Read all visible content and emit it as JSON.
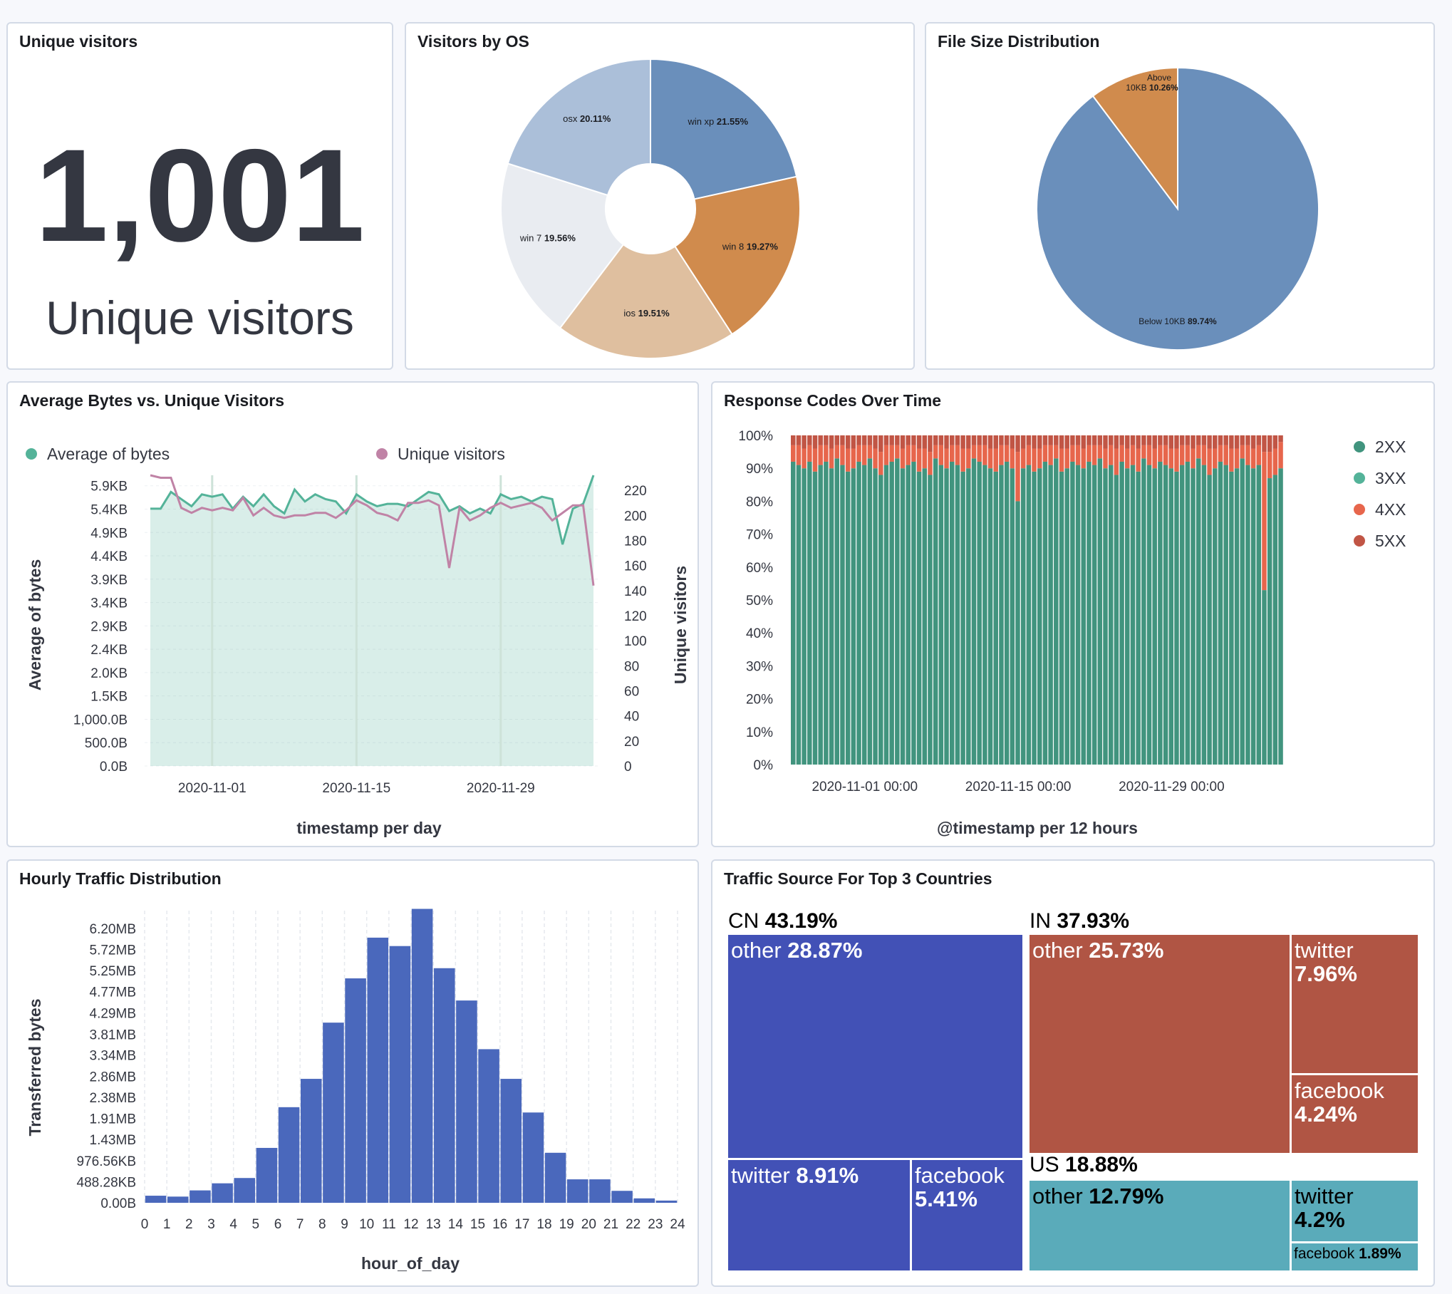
{
  "panels": {
    "metric": {
      "title": "Unique visitors",
      "value": "1,001",
      "label": "Unique visitors"
    },
    "os": {
      "title": "Visitors by OS",
      "chart_data": {
        "type": "pie",
        "donut": true,
        "slices": [
          {
            "name": "win xp",
            "pct": "21.55%",
            "value": 21.55,
            "color": "#6a8fbb"
          },
          {
            "name": "win 8",
            "pct": "19.27%",
            "value": 19.27,
            "color": "#d08b4d"
          },
          {
            "name": "ios",
            "pct": "19.51%",
            "value": 19.51,
            "color": "#dfbf9f"
          },
          {
            "name": "win 7",
            "pct": "19.56%",
            "value": 19.56,
            "color": "#e9ecf1"
          },
          {
            "name": "osx",
            "pct": "20.11%",
            "value": 20.11,
            "color": "#abbfd9"
          }
        ]
      }
    },
    "filesize": {
      "title": "File Size Distribution",
      "chart_data": {
        "type": "pie",
        "slices": [
          {
            "name": "Below 10KB",
            "pct": "89.74%",
            "value": 89.74,
            "color": "#6a8fbb"
          },
          {
            "name": "Above 10KB",
            "name_lines": [
              "Above",
              "10KB"
            ],
            "pct": "10.26%",
            "value": 10.26,
            "color": "#d08b4d"
          }
        ]
      }
    },
    "bytes": {
      "title": "Average Bytes vs. Unique Visitors",
      "legend": [
        {
          "name": "Average of bytes",
          "color": "#54b399"
        },
        {
          "name": "Unique visitors",
          "color": "#c083a6"
        }
      ],
      "chart_data": {
        "type": "line",
        "xlabel": "timestamp per day",
        "ylabel": "Average of bytes",
        "y2label": "Unique visitors",
        "x_ticks": [
          "2020-11-01",
          "2020-11-15",
          "2020-11-29"
        ],
        "x_tick_index": [
          6,
          20,
          34
        ],
        "y_ticks": [
          "0.0B",
          "500.0B",
          "1,000.0B",
          "1.5KB",
          "2.0KB",
          "2.4KB",
          "2.9KB",
          "3.4KB",
          "3.9KB",
          "4.4KB",
          "4.9KB",
          "5.4KB",
          "5.9KB"
        ],
        "y2_ticks": [
          "0",
          "20",
          "40",
          "60",
          "80",
          "100",
          "120",
          "140",
          "160",
          "180",
          "200",
          "220"
        ],
        "y_kb_max": 6.1,
        "y2_max": 232,
        "series": [
          {
            "name": "Average of bytes",
            "values": [
              5.4,
              5.4,
              5.75,
              5.6,
              5.45,
              5.7,
              5.65,
              5.7,
              5.4,
              5.65,
              5.45,
              5.7,
              5.45,
              5.3,
              5.8,
              5.55,
              5.7,
              5.6,
              5.55,
              5.3,
              5.7,
              5.55,
              5.45,
              5.5,
              5.5,
              5.45,
              5.6,
              5.75,
              5.7,
              5.35,
              5.45,
              5.3,
              5.4,
              5.3,
              5.7,
              5.6,
              5.65,
              5.55,
              5.65,
              5.6,
              4.65,
              5.4,
              5.5,
              6.1
            ]
          },
          {
            "name": "Unique visitors",
            "values": [
              232,
              230,
              230,
              206,
              202,
              206,
              204,
              206,
              204,
              214,
              200,
              206,
              200,
              198,
              200,
              200,
              202,
              202,
              198,
              204,
              212,
              208,
              202,
              200,
              196,
              210,
              210,
              212,
              208,
              158,
              206,
              196,
              200,
              206,
              210,
              206,
              208,
              210,
              206,
              196,
              202,
              208,
              208,
              144
            ]
          }
        ]
      }
    },
    "codes": {
      "title": "Response Codes Over Time",
      "legend": [
        {
          "name": "2XX",
          "color": "#41947e"
        },
        {
          "name": "3XX",
          "color": "#54b399"
        },
        {
          "name": "4XX",
          "color": "#e7664c"
        },
        {
          "name": "5XX",
          "color": "#c15545"
        }
      ],
      "chart_data": {
        "type": "bar",
        "stacked": true,
        "xlabel": "@timestamp per 12 hours",
        "x_ticks": [
          "2020-11-01 00:00",
          "2020-11-15 00:00",
          "2020-11-29 00:00"
        ],
        "x_tick_index": [
          13,
          41,
          69
        ],
        "y_ticks": [
          "0%",
          "10%",
          "20%",
          "30%",
          "40%",
          "50%",
          "60%",
          "70%",
          "80%",
          "90%",
          "100%"
        ],
        "series": [
          {
            "name": "2XX",
            "values": [
              92,
              91,
              90,
              92,
              89,
              91,
              92,
              90,
              93,
              91,
              89,
              90,
              92,
              91,
              93,
              90,
              88,
              91,
              92,
              93,
              90,
              91,
              92,
              89,
              90,
              88,
              93,
              91,
              90,
              92,
              91,
              89,
              90,
              93,
              92,
              91,
              90,
              89,
              91,
              92,
              90,
              80,
              90,
              91,
              89,
              90,
              92,
              91,
              93,
              89,
              90,
              92,
              91,
              90,
              92,
              91,
              93,
              90,
              91,
              88,
              92,
              90,
              91,
              89,
              93,
              91,
              90,
              92,
              91,
              90,
              89,
              91,
              92,
              90,
              93,
              91,
              88,
              90,
              92,
              91,
              89,
              90,
              93,
              91,
              90,
              91,
              53,
              87,
              88,
              90
            ]
          },
          {
            "name": "4XX",
            "values": [
              5,
              6,
              6,
              5,
              7,
              6,
              5,
              6,
              4,
              6,
              7,
              6,
              5,
              6,
              4,
              6,
              7,
              6,
              5,
              4,
              6,
              6,
              5,
              7,
              6,
              7,
              4,
              6,
              6,
              5,
              6,
              7,
              6,
              4,
              5,
              6,
              6,
              7,
              6,
              5,
              6,
              15,
              6,
              6,
              7,
              6,
              5,
              6,
              4,
              7,
              6,
              5,
              6,
              6,
              5,
              6,
              4,
              6,
              6,
              8,
              5,
              6,
              6,
              7,
              4,
              6,
              6,
              5,
              6,
              6,
              7,
              6,
              5,
              6,
              4,
              6,
              8,
              6,
              5,
              6,
              7,
              6,
              4,
              6,
              6,
              6,
              42,
              8,
              8,
              8
            ]
          },
          {
            "name": "5XX",
            "values": [
              3,
              3,
              4,
              3,
              4,
              3,
              3,
              4,
              3,
              3,
              4,
              4,
              3,
              3,
              3,
              4,
              5,
              3,
              3,
              3,
              4,
              3,
              3,
              4,
              4,
              5,
              3,
              3,
              4,
              3,
              3,
              4,
              4,
              3,
              3,
              3,
              4,
              4,
              3,
              3,
              4,
              5,
              4,
              3,
              4,
              4,
              3,
              3,
              3,
              4,
              4,
              3,
              3,
              4,
              3,
              3,
              3,
              4,
              3,
              4,
              3,
              4,
              3,
              4,
              3,
              3,
              4,
              3,
              3,
              4,
              4,
              3,
              3,
              4,
              3,
              3,
              4,
              4,
              3,
              3,
              4,
              4,
              3,
              3,
              4,
              3,
              5,
              5,
              4,
              2
            ]
          }
        ]
      }
    },
    "hourly": {
      "title": "Hourly Traffic Distribution",
      "chart_data": {
        "type": "bar",
        "xlabel": "hour_of_day",
        "ylabel": "Transferred bytes",
        "color": "#4a68bc",
        "x_ticks": [
          "0",
          "1",
          "2",
          "3",
          "4",
          "5",
          "6",
          "7",
          "8",
          "9",
          "10",
          "11",
          "12",
          "13",
          "14",
          "15",
          "16",
          "17",
          "18",
          "19",
          "20",
          "21",
          "22",
          "23",
          "24"
        ],
        "y_ticks": [
          "0.00B",
          "488.28KB",
          "976.56KB",
          "1.43MB",
          "1.91MB",
          "2.38MB",
          "2.86MB",
          "3.34MB",
          "3.81MB",
          "4.29MB",
          "4.77MB",
          "5.25MB",
          "5.72MB",
          "6.20MB"
        ],
        "y_max_mb": 6.6,
        "values_mb": [
          0.16,
          0.14,
          0.28,
          0.44,
          0.56,
          1.24,
          2.16,
          2.8,
          4.07,
          5.07,
          5.99,
          5.8,
          6.64,
          5.3,
          4.57,
          3.47,
          2.8,
          2.04,
          1.13,
          0.53,
          0.53,
          0.27,
          0.1,
          0.05
        ]
      }
    },
    "traffic": {
      "title": "Traffic Source For Top 3 Countries",
      "chart_data": {
        "type": "treemap",
        "groups": [
          {
            "name": "CN",
            "pct": "43.19%",
            "color": "#4251b6",
            "children": [
              {
                "name": "other",
                "pct": "28.87%"
              },
              {
                "name": "twitter",
                "pct": "8.91%"
              },
              {
                "name": "facebook",
                "pct": "5.41%"
              }
            ]
          },
          {
            "name": "IN",
            "pct": "37.93%",
            "color": "#b05544",
            "children": [
              {
                "name": "other",
                "pct": "25.73%"
              },
              {
                "name": "twitter",
                "pct": "7.96%"
              },
              {
                "name": "facebook",
                "pct": "4.24%"
              }
            ]
          },
          {
            "name": "US",
            "pct": "18.88%",
            "color": "#5aabba",
            "children": [
              {
                "name": "other",
                "pct": "12.79%"
              },
              {
                "name": "twitter",
                "pct": "4.2%"
              },
              {
                "name": "facebook",
                "pct": "1.89%"
              }
            ]
          }
        ]
      }
    }
  }
}
